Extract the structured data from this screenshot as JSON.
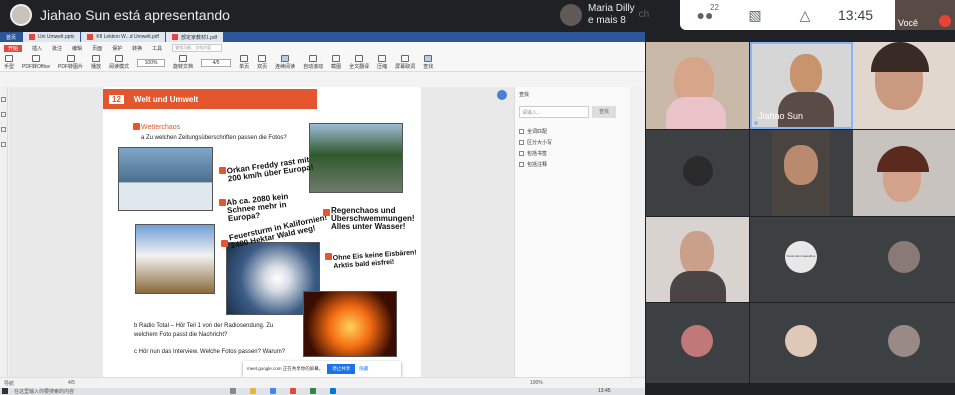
{
  "presenter": {
    "text": "Jiahao Sun está apresentando"
  },
  "pinned": {
    "name": "Maria Dilly",
    "extra": "e mais 8",
    "overlap": "ch"
  },
  "controls": {
    "people_count": "22",
    "time": "13:45"
  },
  "self_tile": {
    "label": "Você"
  },
  "tabs": [
    {
      "label": "首页"
    },
    {
      "label": "Uni Umwelt.pptx"
    },
    {
      "label": "Kfl Lektion W...d Umwelt.pdf"
    },
    {
      "label": "部定家教材1.pdf"
    }
  ],
  "menu": {
    "file": "开始",
    "items": [
      "插入",
      "批注",
      "编辑",
      "页面",
      "保护",
      "转换",
      "工具"
    ],
    "search_placeholder": "查找功能、文档内容"
  },
  "toolbar": {
    "items": [
      "手型",
      "选择",
      "PDF转Office",
      "PDF转图片",
      "播放",
      "阅读模式",
      "旋转文档",
      "单页",
      "双页",
      "连续阅读",
      "自动滚动",
      "截图",
      "全文翻译",
      "压缩",
      "屏幕取词",
      "查找"
    ],
    "zoom": "100%",
    "page": "4/5"
  },
  "doc": {
    "banner_num": "12",
    "banner_title": "Welt und Umwelt",
    "section": "Wetterchaos",
    "question": "a  Zu welchen Zeitungsüberschriften passen die Fotos?",
    "headline_1": "Orkan Freddy rast mit 200 km/h über Europa!",
    "headline_2": "Ab ca. 2080 kein Schnee mehr in Europa?",
    "headline_3": "Feuersturm in Kalifornien! 2400 Hektar Wald weg!",
    "headline_4": "Regenchaos und Überschwemmungen! Alles unter Wasser!",
    "headline_5": "Ohne Eis keine Eisbären! Arktis bald eisfrei!",
    "radio": "b  Radio Total – Hör Teil 1 von der Radiosendung. Zu welchem Foto passt die Nachricht?",
    "interview": "c  Hör nun das Interview. Welche Fotos passen? Warum?"
  },
  "right_panel": {
    "title": "查找",
    "search_placeholder": "请输入...",
    "search_btn": "查找",
    "options": [
      "全词匹配",
      "区分大小写",
      "包括书签",
      "包括注释"
    ]
  },
  "status": {
    "nav": "导航",
    "page": "4/5",
    "zoom": "100%"
  },
  "notification": {
    "text": "meet.google.com 正在共享你的屏幕。",
    "stop": "停止共享",
    "hide": "隐藏"
  },
  "taskbar": {
    "search": "在这里输入你要搜索的内容",
    "time": "13:45"
  },
  "tiles": [
    {
      "name": ""
    },
    {
      "name": "Jiahao Sun"
    },
    {
      "name": ""
    },
    {
      "name": ""
    },
    {
      "name": ""
    },
    {
      "name": ""
    },
    {
      "name": ""
    },
    {
      "name": "",
      "label": "Futuro Em Guarulhos"
    },
    {
      "name": ""
    },
    {
      "name": ""
    },
    {
      "name": ""
    },
    {
      "name": ""
    }
  ]
}
